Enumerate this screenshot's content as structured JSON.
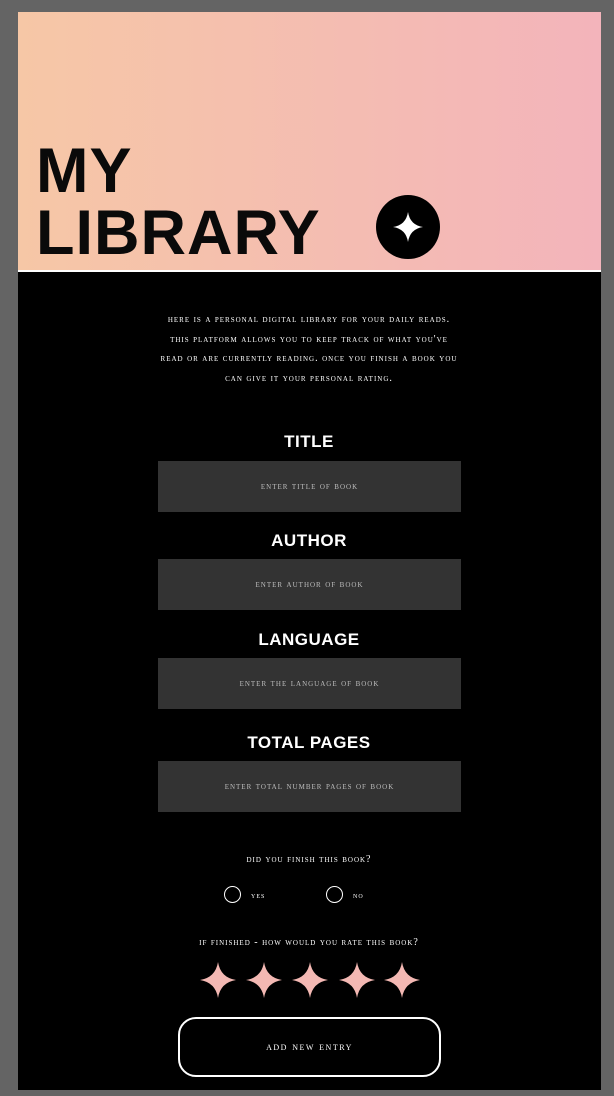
{
  "header": {
    "title_line1": "MY",
    "title_line2": "LIBRARY",
    "badge_icon": "sparkle-icon"
  },
  "intro": "HERE IS A PERSONAL DIGITAL LIBRARY FOR YOUR DAILY READS. THIS PLATFORM ALLOWS YOU TO KEEP TRACK OF WHAT YOU'VE READ OR ARE CURRENTLY READING. ONCE YOU FINISH A BOOK YOU CAN GIVE IT YOUR PERSONAL RATING.",
  "form": {
    "title": {
      "label": "TITLE",
      "placeholder": "ENTER TITLE OF BOOK",
      "value": ""
    },
    "author": {
      "label": "AUTHOR",
      "placeholder": "ENTER AUTHOR OF BOOK",
      "value": ""
    },
    "language": {
      "label": "LANGUAGE",
      "placeholder": "ENTER THE LANGUAGE OF BOOK",
      "value": ""
    },
    "pages": {
      "label": "TOTAL PAGES",
      "placeholder": "ENTER TOTAL NUMBER PAGES OF BOOK",
      "value": ""
    },
    "finished": {
      "question": "DID YOU FINISH THIS BOOK?",
      "options": [
        "YES",
        "NO"
      ],
      "selected": ""
    },
    "rating": {
      "question": "IF FINISHED - HOW WOULD YOU RATE THIS BOOK?",
      "max": 5,
      "value": 0
    },
    "submit_label": "ADD NEW ENTRY"
  },
  "colors": {
    "gradient_start": "#f6c7a6",
    "gradient_end": "#f3b4bb",
    "star": "#f3b8b3",
    "input_bg": "#333333"
  }
}
